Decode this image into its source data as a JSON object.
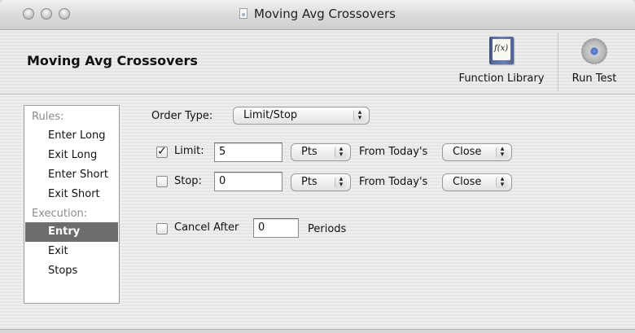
{
  "window": {
    "title": "Moving Avg Crossovers"
  },
  "header": {
    "title": "Moving Avg Crossovers",
    "tools": {
      "function_library": "Function Library",
      "function_library_icon_text": "f(x)",
      "run_test": "Run Test"
    }
  },
  "sidebar": {
    "groups": [
      {
        "label": "Rules:"
      },
      {
        "label": "Execution:"
      }
    ],
    "rules_items": [
      "Enter Long",
      "Exit Long",
      "Enter Short",
      "Exit Short"
    ],
    "execution_items": [
      "Entry",
      "Exit",
      "Stops"
    ],
    "selected": "Entry"
  },
  "form": {
    "order_type_label": "Order Type:",
    "order_type_value": "Limit/Stop",
    "limit": {
      "checked": true,
      "label": "Limit:",
      "value": "5",
      "unit": "Pts",
      "from_label": "From Today's",
      "price": "Close"
    },
    "stop": {
      "checked": false,
      "label": "Stop:",
      "value": "0",
      "unit": "Pts",
      "from_label": "From Today's",
      "price": "Close"
    },
    "cancel": {
      "checked": false,
      "label": "Cancel After",
      "value": "0",
      "suffix": "Periods"
    }
  }
}
